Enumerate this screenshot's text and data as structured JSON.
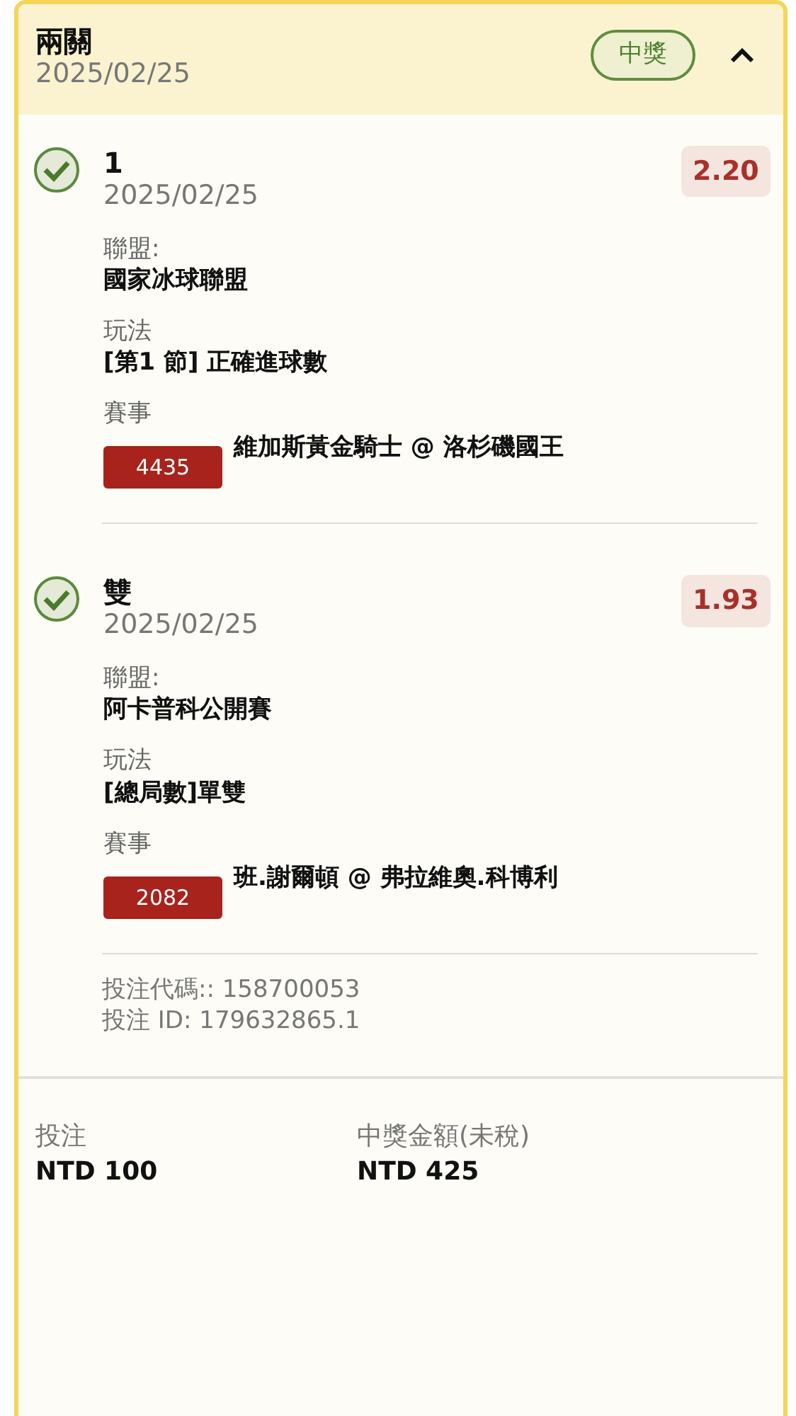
{
  "bet": {
    "title": "兩關",
    "date": "2025/02/25",
    "status": "中獎",
    "expanded": true
  },
  "legs": [
    {
      "won": true,
      "selection": "1",
      "date": "2025/02/25",
      "odds": "2.20",
      "league_label": "聯盟:",
      "league": "國家冰球聯盟",
      "market_label": "玩法",
      "market": "[第1 節] 正確進球數",
      "event_label": "賽事",
      "event_id": "4435",
      "event": "維加斯黃金騎士 @ 洛杉磯國王"
    },
    {
      "won": true,
      "selection": "雙",
      "date": "2025/02/25",
      "odds": "1.93",
      "league_label": "聯盟:",
      "league": "阿卡普科公開賽",
      "market_label": "玩法",
      "market": "[總局數]單雙",
      "event_label": "賽事",
      "event_id": "2082",
      "event": "班.謝爾頓 @ 弗拉維奧.科博利"
    }
  ],
  "codes": [
    "投注代碼:: 158700053",
    "投注 ID: 179632865.1"
  ],
  "summary": [
    {
      "label": "投注",
      "value": "NTD 100"
    },
    {
      "label": "中獎金額(未稅)",
      "value": "NTD 425"
    }
  ]
}
